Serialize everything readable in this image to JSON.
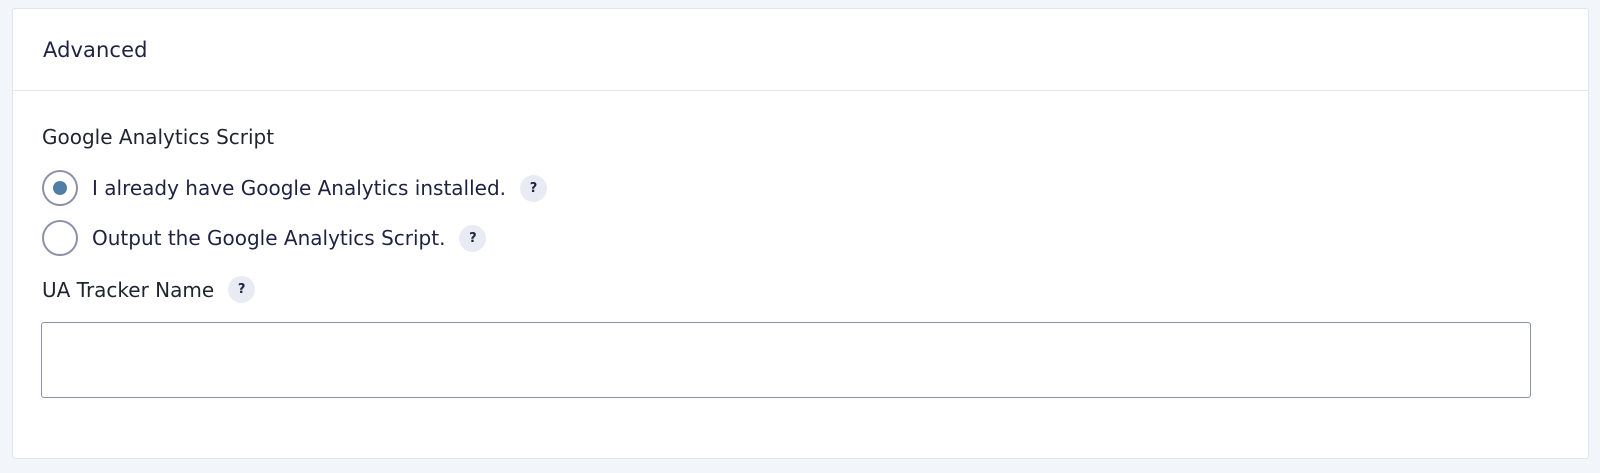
{
  "panel": {
    "title": "Advanced"
  },
  "script_field": {
    "label": "Google Analytics Script",
    "options": [
      {
        "label": "I already have Google Analytics installed.",
        "selected": true,
        "help": "?"
      },
      {
        "label": "Output the Google Analytics Script.",
        "selected": false,
        "help": "?"
      }
    ]
  },
  "tracker_field": {
    "label": "UA Tracker Name",
    "help": "?",
    "value": "",
    "placeholder": ""
  },
  "colors": {
    "accent": "#4f7ea7",
    "border": "#8c90a8",
    "help_bg": "#e8ebf4"
  },
  "icons": {
    "help": "question-mark-icon"
  }
}
